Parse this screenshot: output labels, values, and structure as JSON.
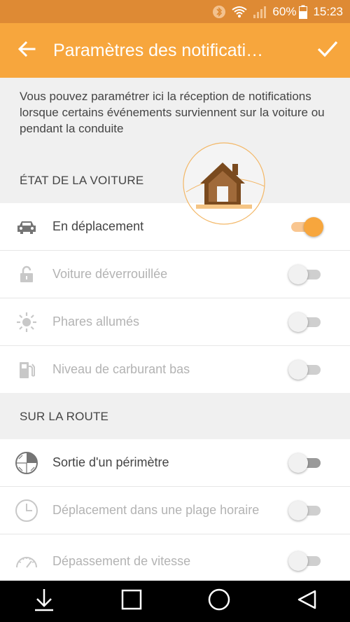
{
  "status_bar": {
    "battery": "60%",
    "time": "15:23"
  },
  "app_bar": {
    "title": "Paramètres des notificati…"
  },
  "intro": {
    "text": "Vous pouvez paramétrer ici la réception de notifications lorsque certains événements surviennent sur la voiture ou pendant la conduite"
  },
  "sections": [
    {
      "header": "ÉTAT DE LA VOITURE",
      "items": [
        {
          "label": "En déplacement",
          "enabled": true,
          "checked": true,
          "icon": "car-icon"
        },
        {
          "label": "Voiture déverrouillée",
          "enabled": false,
          "checked": false,
          "icon": "unlock-icon"
        },
        {
          "label": "Phares allumés",
          "enabled": false,
          "checked": false,
          "icon": "sun-icon"
        },
        {
          "label": "Niveau de carburant bas",
          "enabled": false,
          "checked": false,
          "icon": "fuel-pump-icon"
        }
      ]
    },
    {
      "header": "SUR LA ROUTE",
      "items": [
        {
          "label": "Sortie d'un périmètre",
          "enabled": true,
          "checked": false,
          "icon": "perimeter-icon"
        },
        {
          "label": "Déplacement dans une plage horaire",
          "enabled": false,
          "checked": false,
          "icon": "clock-icon"
        },
        {
          "label": "Dépassement de vitesse",
          "enabled": false,
          "checked": false,
          "icon": "speedometer-icon"
        }
      ]
    }
  ],
  "colors": {
    "accent": "#f7a63d",
    "status_bar": "#de8a34",
    "background": "#f0f0f0",
    "disabled_text": "#b3b3b3"
  }
}
